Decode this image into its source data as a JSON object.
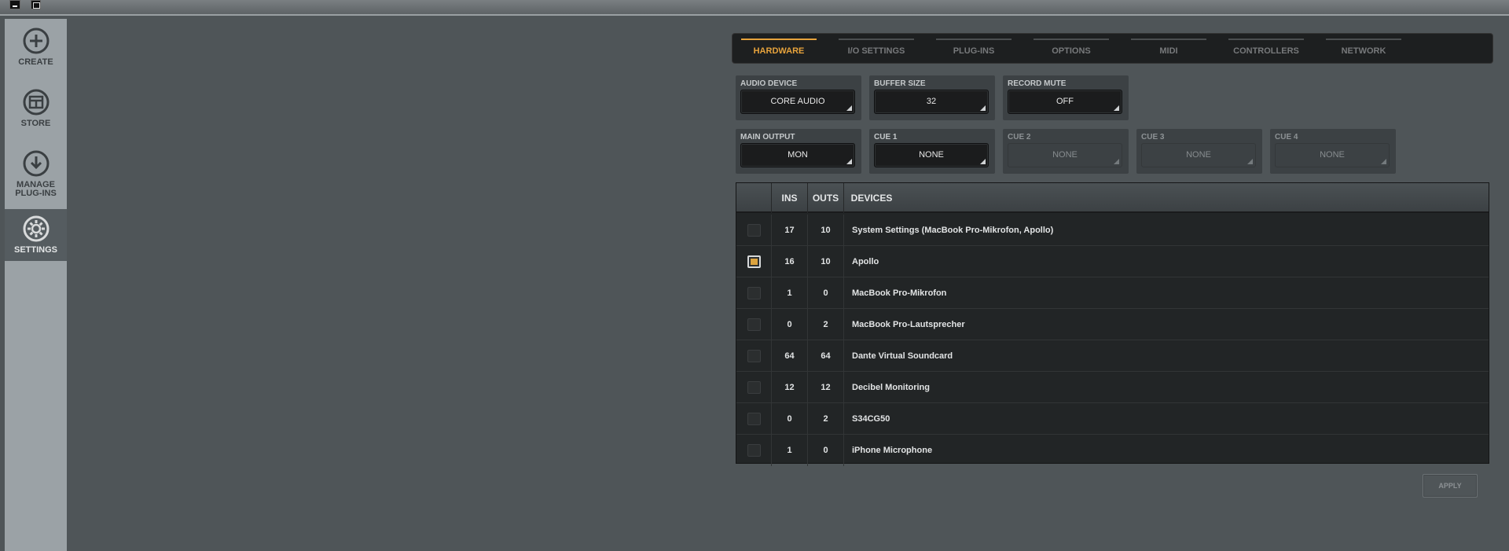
{
  "sidebar": {
    "items": [
      {
        "label": "CREATE",
        "icon": "plus-circle-icon"
      },
      {
        "label": "STORE",
        "icon": "store-grid-icon"
      },
      {
        "label": "MANAGE PLUG-INS",
        "icon": "download-circle-icon"
      },
      {
        "label": "SETTINGS",
        "icon": "gear-icon",
        "active": true
      }
    ]
  },
  "tabs": [
    "HARDWARE",
    "I/O SETTINGS",
    "PLUG-INS",
    "OPTIONS",
    "MIDI",
    "CONTROLLERS",
    "NETWORK"
  ],
  "active_tab": "HARDWARE",
  "fields": {
    "audio_device": {
      "label": "AUDIO DEVICE",
      "value": "CORE AUDIO"
    },
    "buffer_size": {
      "label": "BUFFER SIZE",
      "value": "32"
    },
    "record_mute": {
      "label": "RECORD MUTE",
      "value": "OFF"
    },
    "main_output": {
      "label": "MAIN OUTPUT",
      "value": "MON"
    },
    "cue1": {
      "label": "CUE 1",
      "value": "NONE"
    },
    "cue2": {
      "label": "CUE 2",
      "value": "NONE"
    },
    "cue3": {
      "label": "CUE 3",
      "value": "NONE"
    },
    "cue4": {
      "label": "CUE 4",
      "value": "NONE"
    }
  },
  "table": {
    "headers": {
      "ins": "INS",
      "outs": "OUTS",
      "devices": "DEVICES"
    },
    "rows": [
      {
        "checked": false,
        "ins": "17",
        "outs": "10",
        "device": "System Settings (MacBook Pro-Mikrofon, Apollo)"
      },
      {
        "checked": true,
        "ins": "16",
        "outs": "10",
        "device": "Apollo"
      },
      {
        "checked": false,
        "ins": "1",
        "outs": "0",
        "device": "MacBook Pro-Mikrofon"
      },
      {
        "checked": false,
        "ins": "0",
        "outs": "2",
        "device": "MacBook Pro-Lautsprecher"
      },
      {
        "checked": false,
        "ins": "64",
        "outs": "64",
        "device": "Dante Virtual Soundcard"
      },
      {
        "checked": false,
        "ins": "12",
        "outs": "12",
        "device": "Decibel Monitoring"
      },
      {
        "checked": false,
        "ins": "0",
        "outs": "2",
        "device": "S34CG50"
      },
      {
        "checked": false,
        "ins": "1",
        "outs": "0",
        "device": "iPhone Microphone"
      }
    ]
  },
  "apply_label": "APPLY",
  "colors": {
    "accent": "#e7a33c",
    "background": "#4f5558",
    "sidebar": "#9ba2a6"
  }
}
